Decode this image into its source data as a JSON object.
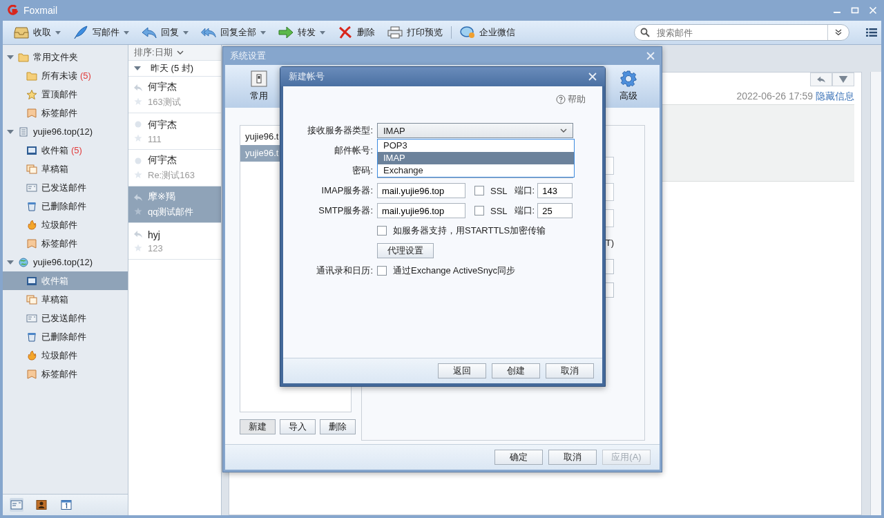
{
  "window": {
    "title": "Foxmail"
  },
  "toolbar": {
    "buttons": [
      {
        "label": "收取",
        "dropdown": true
      },
      {
        "label": "写邮件",
        "dropdown": true
      },
      {
        "label": "回复",
        "dropdown": true
      },
      {
        "label": "回复全部",
        "dropdown": true
      },
      {
        "label": "转发",
        "dropdown": true
      },
      {
        "label": "删除",
        "dropdown": false
      },
      {
        "label": "打印预览",
        "dropdown": false
      },
      {
        "label": "企业微信",
        "dropdown": false
      }
    ],
    "search": {
      "placeholder": "搜索邮件"
    }
  },
  "sidebar": {
    "groups": [
      {
        "label": "常用文件夹",
        "kind": "folder",
        "expanded": true,
        "children": [
          {
            "label": "所有未读",
            "kind": "folder",
            "count": "(5)",
            "selected": false
          },
          {
            "label": "置顶邮件",
            "kind": "starred",
            "selected": false
          },
          {
            "label": "标签邮件",
            "kind": "tagged",
            "selected": false
          }
        ]
      },
      {
        "label": "yujie96.top(12)",
        "kind": "account",
        "expanded": true,
        "children": [
          {
            "label": "收件箱",
            "kind": "inbox",
            "count": "(5)",
            "selected": false
          },
          {
            "label": "草稿箱",
            "kind": "drafts",
            "selected": false
          },
          {
            "label": "已发送邮件",
            "kind": "sent",
            "selected": false
          },
          {
            "label": "已删除邮件",
            "kind": "trash",
            "selected": false
          },
          {
            "label": "垃圾邮件",
            "kind": "junk",
            "selected": false
          },
          {
            "label": "标签邮件",
            "kind": "tagged",
            "selected": false
          }
        ]
      },
      {
        "label": "yujie96.top(12)",
        "kind": "globe",
        "expanded": true,
        "children": [
          {
            "label": "收件箱",
            "kind": "inbox",
            "selected": true
          },
          {
            "label": "草稿箱",
            "kind": "drafts",
            "selected": false
          },
          {
            "label": "已发送邮件",
            "kind": "sent",
            "selected": false
          },
          {
            "label": "已删除邮件",
            "kind": "trash",
            "selected": false
          },
          {
            "label": "垃圾邮件",
            "kind": "junk",
            "selected": false
          },
          {
            "label": "标签邮件",
            "kind": "tagged",
            "selected": false
          }
        ]
      }
    ],
    "bottom_tabs": [
      {
        "kind": "mail",
        "selected": true
      },
      {
        "kind": "contacts",
        "selected": false
      },
      {
        "kind": "calendar",
        "selected": false
      }
    ]
  },
  "message_list": {
    "sort": "排序:日期",
    "group": {
      "label": "昨天 (5 封)",
      "expanded": true
    },
    "messages": [
      {
        "sender": "何宇杰",
        "subject": "163测试",
        "replied": true,
        "selected": false
      },
      {
        "sender": "何宇杰",
        "subject": "111",
        "replied": false,
        "selected": false
      },
      {
        "sender": "何宇杰",
        "subject": "Re:测试163",
        "replied": false,
        "selected": false
      },
      {
        "sender": "摩※羯",
        "subject": "qq测试邮件",
        "replied": true,
        "selected": true
      },
      {
        "sender": "hyj",
        "subject": "123",
        "replied": true,
        "selected": false
      }
    ]
  },
  "reading_pane": {
    "date": "2022-06-26 17:59",
    "link": "隐藏信息"
  },
  "settings_dialog": {
    "title": "系统设置",
    "tabs": [
      {
        "label": "常用",
        "kind": "general",
        "selected": false
      },
      {
        "label": "高级",
        "kind": "advanced",
        "selected": false
      }
    ],
    "accounts": [
      {
        "label": "yujie96.t",
        "selected": false
      },
      {
        "label": "yujie96.t",
        "selected": true
      }
    ],
    "account_buttons": [
      "新建",
      "导入",
      "删除"
    ],
    "partial_text": "T)",
    "buttons": [
      {
        "label": "确定",
        "disabled": false
      },
      {
        "label": "取消",
        "disabled": false
      },
      {
        "label": "应用(A)",
        "disabled": true
      }
    ]
  },
  "new_account_dialog": {
    "title": "新建帐号",
    "help": "帮助",
    "server_type": {
      "label": "接收服务器类型:",
      "value": "IMAP",
      "expanded": true,
      "options": [
        {
          "label": "POP3",
          "selected": false
        },
        {
          "label": "IMAP",
          "selected": true
        },
        {
          "label": "Exchange",
          "selected": false
        }
      ]
    },
    "account_label": "邮件帐号:",
    "password_label": "密码:",
    "servers": [
      {
        "label": "IMAP服务器:",
        "value": "mail.yujie96.top",
        "ssl_label": "SSL",
        "ssl": false,
        "port_label": "端口:",
        "port": "143"
      },
      {
        "label": "SMTP服务器:",
        "value": "mail.yujie96.top",
        "ssl_label": "SSL",
        "ssl": false,
        "port_label": "端口:",
        "port": "25"
      }
    ],
    "starttls": {
      "label": "如服务器支持，用STARTTLS加密传输",
      "checked": false
    },
    "proxy_button": "代理设置",
    "sync": {
      "label": "通讯录和日历:",
      "option": "通过Exchange ActiveSnyc同步",
      "checked": false
    },
    "buttons": [
      "返回",
      "创建",
      "取消"
    ]
  }
}
